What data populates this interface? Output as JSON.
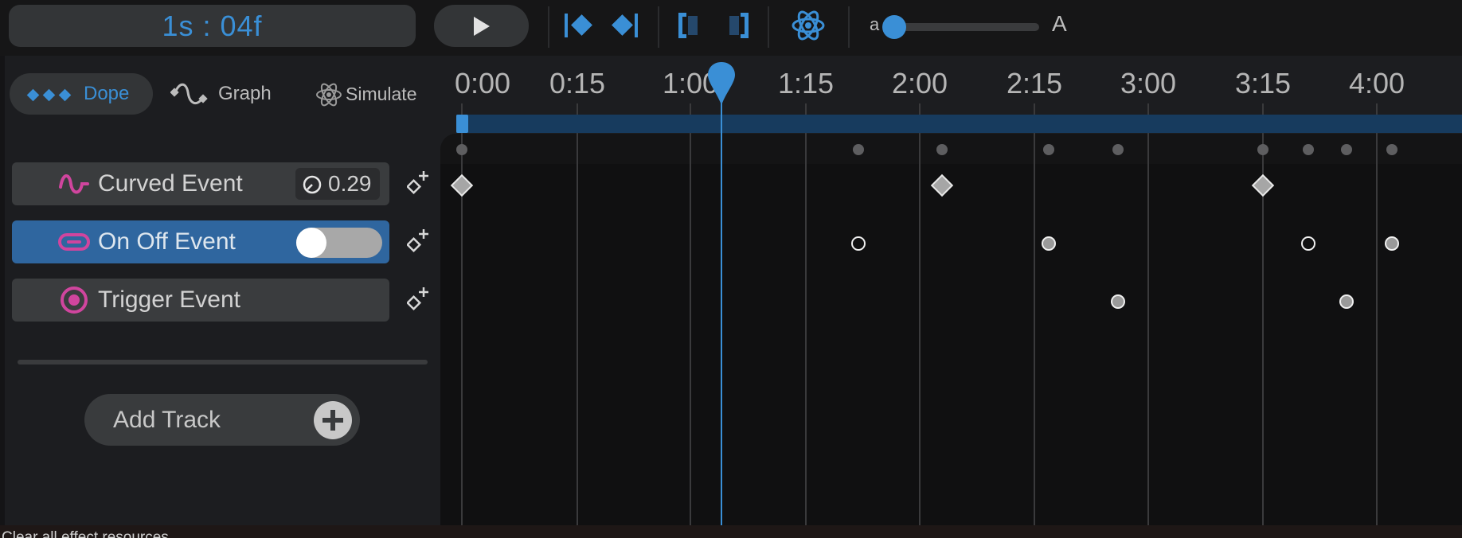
{
  "toolbar": {
    "time_display": "1s : 04f",
    "play_icon": "play-icon",
    "icons": [
      "jump-to-previous-keyframe-icon",
      "jump-to-next-keyframe-icon",
      "set-range-start-icon",
      "set-range-end-icon",
      "physics-atom-icon"
    ],
    "slider": {
      "min_label": "a",
      "max_label": "A",
      "value": 0.0
    }
  },
  "mode_tabs": [
    {
      "label": "Dope",
      "icon": "diamonds-icon",
      "active": true
    },
    {
      "label": "Graph",
      "icon": "graph-curve-icon",
      "active": false
    },
    {
      "label": "Simulate",
      "icon": "atom-icon",
      "active": false
    }
  ],
  "tracks": [
    {
      "name": "Curved Event",
      "icon": "curve-icon",
      "value": "0.29",
      "value_icon": "dial-icon"
    },
    {
      "name": "On Off Event",
      "icon": "toggle-icon",
      "toggle_on": false,
      "selected": true
    },
    {
      "name": "Trigger Event",
      "icon": "target-icon"
    }
  ],
  "add_track": {
    "label": "Add Track"
  },
  "timeline": {
    "ruler_labels": [
      "0:00",
      "0:15",
      "1:00",
      "1:15",
      "2:00",
      "2:15",
      "3:00",
      "3:15",
      "4:00"
    ],
    "playhead_icon": "playhead-icon"
  },
  "status": {
    "text": "Clear all effect resources"
  },
  "colors": {
    "accent": "#3a8fd6",
    "track_icon": "#d0459e",
    "selected_track": "#2f669f"
  }
}
